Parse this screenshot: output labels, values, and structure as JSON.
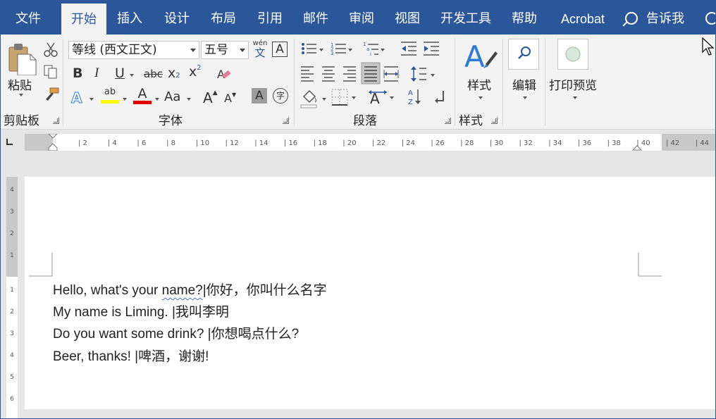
{
  "tabs": [
    "文件",
    "开始",
    "插入",
    "设计",
    "布局",
    "引用",
    "邮件",
    "审阅",
    "视图",
    "开发工具",
    "帮助",
    "Acrobat"
  ],
  "active_tab": "开始",
  "tell_me": "告诉我",
  "ribbon": {
    "clipboard": {
      "paste_label": "粘贴",
      "group_label": "剪贴板"
    },
    "font": {
      "font_name": "等线 (西文正文)",
      "font_size": "五号",
      "pinyin_glyph_top": "wén",
      "pinyin_glyph_bottom": "文",
      "charborder_glyph": "A",
      "bold": "B",
      "italic": "I",
      "underline": "U",
      "strike": "abc",
      "subscript": "x",
      "subscript_sub": "2",
      "superscript": "x",
      "superscript_sup": "2",
      "highlight_glyph": "ab",
      "fontcolor_glyph": "A",
      "changecase_glyph": "Aa",
      "grow_glyph": "A",
      "shrink_glyph": "A",
      "shade_glyph": "A",
      "enclose_glyph": "字",
      "group_label": "字体",
      "highlight_color": "#ffff00",
      "font_color": "#e00000"
    },
    "paragraph": {
      "group_label": "段落"
    },
    "styles": {
      "button_label": "样式",
      "group_label": "样式"
    },
    "editing": {
      "button_label": "编辑"
    },
    "print_preview": {
      "button_label": "打印预览"
    }
  },
  "ruler": {
    "ticks": [
      "2",
      "4",
      "6",
      "8",
      "10",
      "12",
      "14",
      "16",
      "18",
      "20",
      "22",
      "24",
      "26",
      "28",
      "30",
      "32",
      "34",
      "36",
      "38",
      "40",
      "42",
      "44"
    ],
    "vticks": [
      "4",
      "3",
      "2",
      "1",
      "1",
      "2",
      "3",
      "4",
      "5",
      "6"
    ]
  },
  "document": {
    "lines": [
      {
        "pre": "Hello, what's your ",
        "wavy": "name?",
        "post": "|你好，你叫什么名字"
      },
      {
        "pre": "My name is Liming. |我叫李明",
        "wavy": "",
        "post": ""
      },
      {
        "pre": "Do you want some drink? |你想喝点什么?",
        "wavy": "",
        "post": ""
      },
      {
        "pre": "Beer, thanks! |啤酒，谢谢!",
        "wavy": "",
        "post": ""
      }
    ]
  },
  "colors": {
    "accent": "#2b579a",
    "ribbon_bg": "#f3f3f3"
  }
}
